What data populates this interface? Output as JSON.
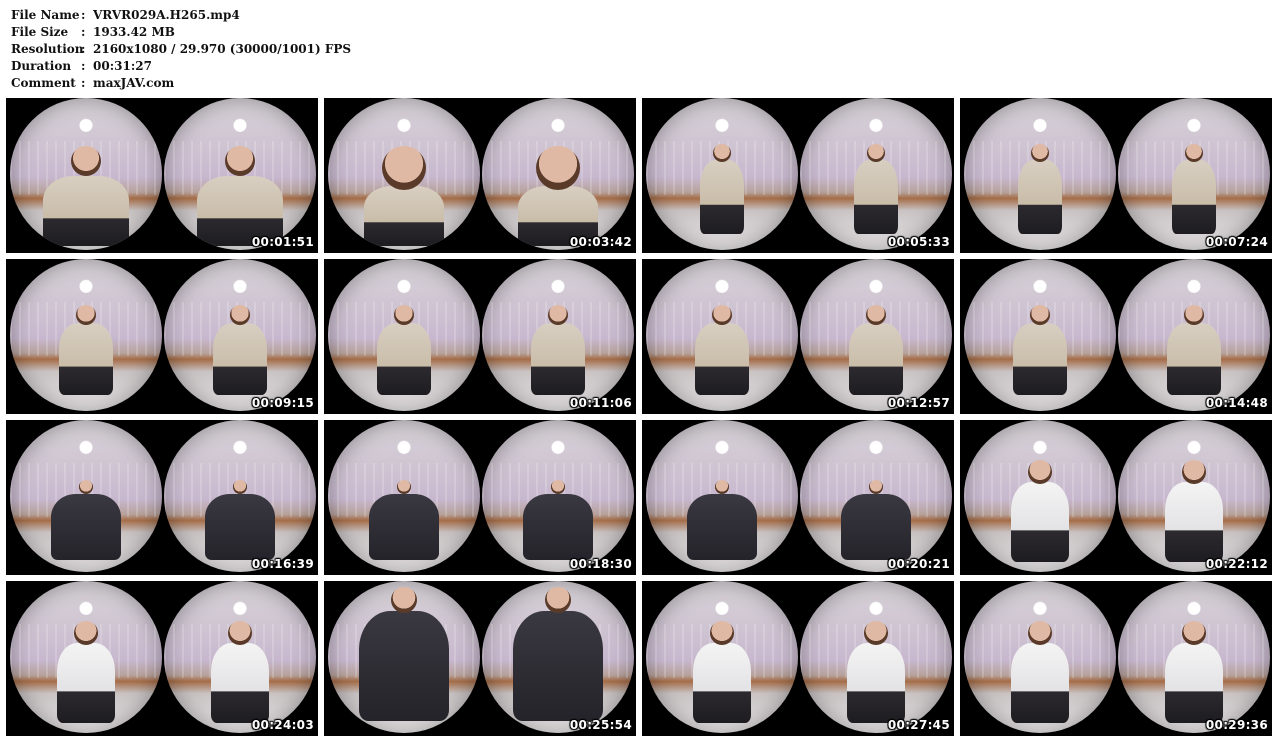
{
  "info": {
    "rows": [
      {
        "key": "File Name",
        "sep": ":",
        "value": "VRVR029A.H265.mp4"
      },
      {
        "key": "File Size",
        "sep": ":",
        "value": "1933.42 MB"
      },
      {
        "key": "Resolution",
        "sep": ":",
        "value": "2160x1080 / 29.970 (30000/1001) FPS"
      },
      {
        "key": "Duration",
        "sep": ":",
        "value": "00:31:27"
      },
      {
        "key": "Comment",
        "sep": ":",
        "value": "maxJAV.com"
      }
    ]
  },
  "thumbnails": [
    {
      "timestamp": "00:01:51",
      "scene": "close"
    },
    {
      "timestamp": "00:03:42",
      "scene": "face"
    },
    {
      "timestamp": "00:05:33",
      "scene": "seated"
    },
    {
      "timestamp": "00:07:24",
      "scene": "seated"
    },
    {
      "timestamp": "00:09:15",
      "scene": "crossed"
    },
    {
      "timestamp": "00:11:06",
      "scene": "crossed"
    },
    {
      "timestamp": "00:12:57",
      "scene": "crossed"
    },
    {
      "timestamp": "00:14:48",
      "scene": "crossed"
    },
    {
      "timestamp": "00:16:39",
      "scene": "legs"
    },
    {
      "timestamp": "00:18:30",
      "scene": "legs"
    },
    {
      "timestamp": "00:20:21",
      "scene": "legs"
    },
    {
      "timestamp": "00:22:12",
      "scene": "white"
    },
    {
      "timestamp": "00:24:03",
      "scene": "white"
    },
    {
      "timestamp": "00:25:54",
      "scene": "closeup"
    },
    {
      "timestamp": "00:27:45",
      "scene": "white"
    },
    {
      "timestamp": "00:29:36",
      "scene": "white"
    }
  ]
}
